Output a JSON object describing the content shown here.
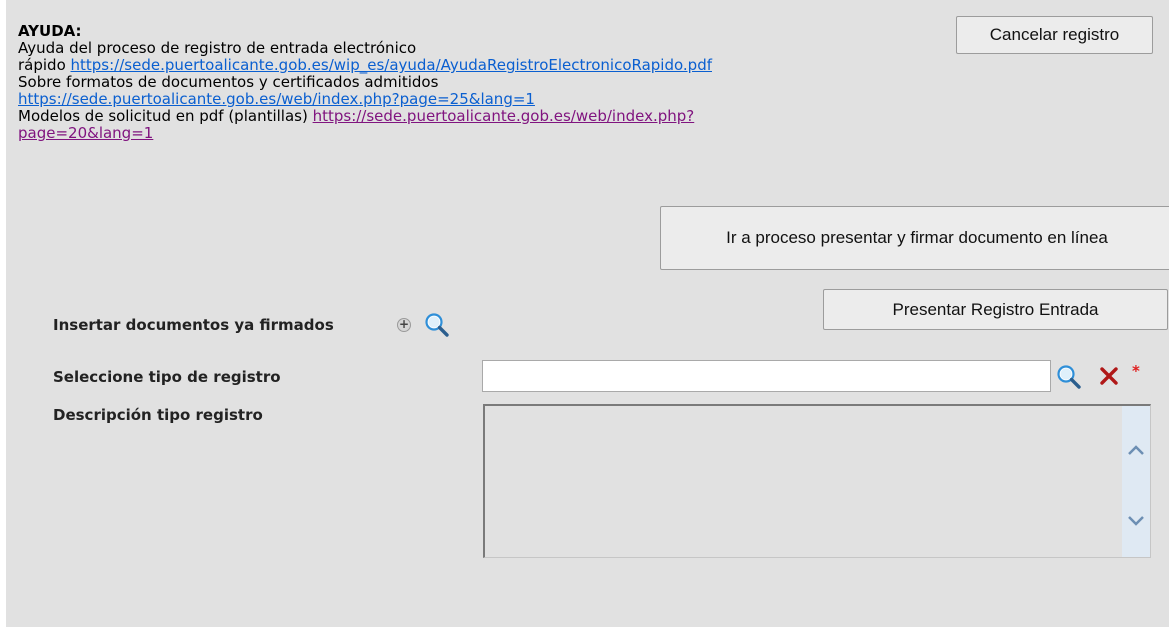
{
  "help": {
    "title": "AYUDA:",
    "line1_text": "Ayuda del proceso de registro de entrada electrónico",
    "line2_prefix": "rápido ",
    "line2_link": "https://sede.puertoalicante.gob.es/wip_es/ayuda/AyudaRegistroElectronicoRapido.pdf",
    "line3_text": "Sobre formatos de documentos y certificados admitidos",
    "line4_link": "https://sede.puertoalicante.gob.es/web/index.php?page=25&lang=1",
    "line5_prefix": "Modelos de solicitud en pdf (plantillas) ",
    "line5_link_part1": "https://sede.puertoalicante.gob.es/web/index.php?",
    "line5_link_part2": "page=20&lang=1"
  },
  "buttons": {
    "cancel": "Cancelar registro",
    "process": "Ir a proceso presentar y firmar documento en línea",
    "present": "Presentar Registro Entrada"
  },
  "form": {
    "insert_label": "Insertar documentos ya firmados",
    "tipo_label": "Seleccione tipo de registro",
    "tipo_value": "",
    "required_mark": "*",
    "desc_label": "Descripción tipo registro"
  },
  "icons": {
    "add": "plus-circle-icon",
    "search": "magnifier-icon",
    "clear": "red-x-icon",
    "scroll_up": "chevron-up-icon",
    "scroll_down": "chevron-down-icon"
  },
  "colors": {
    "background": "#e1e1e1",
    "link_unvisited": "#0a5fd0",
    "link_visited": "#80147f",
    "required": "#e02020",
    "clear_icon": "#b01818"
  }
}
